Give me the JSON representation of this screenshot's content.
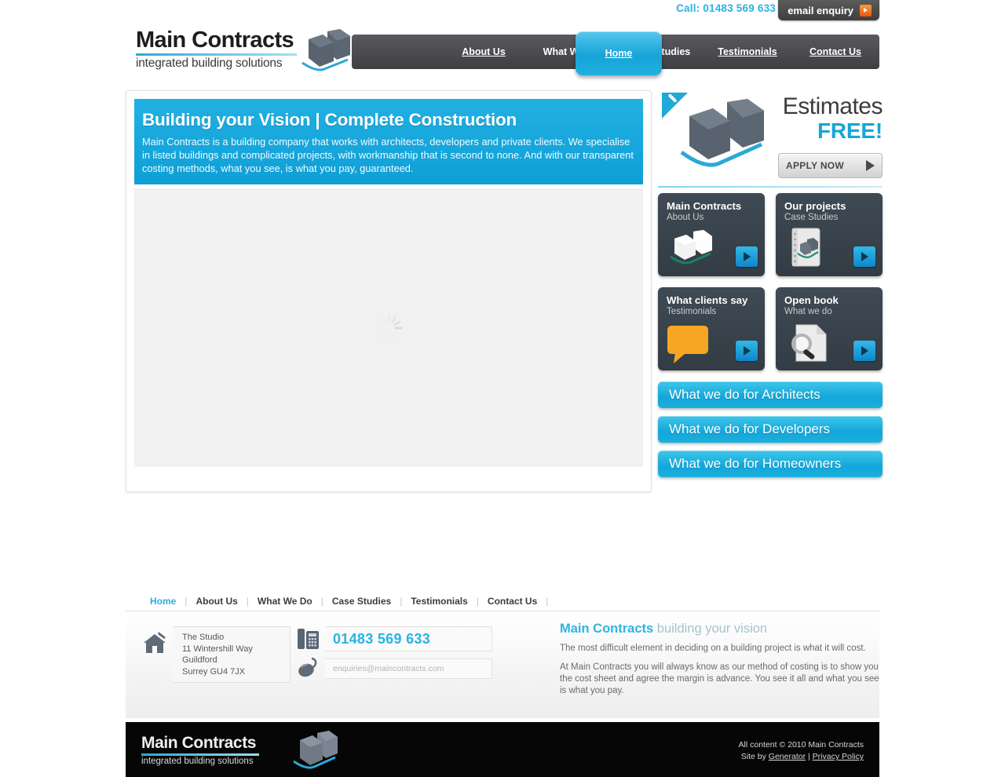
{
  "topbar": {
    "call_text": "Call: 01483 569 633",
    "email_button": "email enquiry",
    "play_icon": "orange-play-icon"
  },
  "logo": {
    "name": "Main Contracts",
    "tagline": "integrated building solutions",
    "mark": "houses-icon"
  },
  "nav": {
    "active": "Home",
    "items": [
      {
        "label": "Home"
      },
      {
        "label": "About Us"
      },
      {
        "label": "What We Do"
      },
      {
        "label": "Case Studies"
      },
      {
        "label": "Testimonials"
      },
      {
        "label": "Contact Us"
      }
    ]
  },
  "banner": {
    "heading": "Building your Vision | Complete Construction",
    "body": "Main Contracts is a building company that works with architects, developers and private clients. We specialise in listed buildings and complicated projects, with workmanship that is second to none. And with our transparent costing methods, what you see, is what you pay, guaranteed.",
    "stage_state": "loading-spinner"
  },
  "estimates": {
    "line1": "Estimates",
    "line2": "FREE!",
    "apply_label": "APPLY NOW",
    "corner_icon": "blue-corner-flag-icon",
    "house_icon": "houses-icon"
  },
  "tiles": [
    {
      "title": "Main Contracts",
      "subtitle": "About Us",
      "icon": "houses-icon"
    },
    {
      "title": "Our projects",
      "subtitle": "Case Studies",
      "icon": "notebook-icon"
    },
    {
      "title": "What clients say",
      "subtitle": "Testimonials",
      "icon": "speech-bubble-icon"
    },
    {
      "title": "Open book",
      "subtitle": "What we do",
      "icon": "magnifier-document-icon"
    }
  ],
  "ctas": [
    {
      "label": "What we do for Architects"
    },
    {
      "label": "What we do for Developers"
    },
    {
      "label": "What we do for Homeowners"
    }
  ],
  "footer_nav": {
    "active": "Home",
    "items": [
      {
        "label": "Home"
      },
      {
        "label": "About Us"
      },
      {
        "label": "What We Do"
      },
      {
        "label": "Case Studies"
      },
      {
        "label": "Testimonials"
      },
      {
        "label": "Contact Us"
      }
    ]
  },
  "contact": {
    "address_lines": [
      "The Studio",
      "11 Wintershill Way",
      "Guildford",
      "Surrey GU4 7JX"
    ],
    "phone": "01483 569 633",
    "email": "enquiries@maincontracts.com",
    "home_icon": "house-icon",
    "phone_icon": "phone-icon",
    "mail_icon": "mouse-icon"
  },
  "blurb": {
    "title_strong": "Main Contracts",
    "title_rest": " building your vision",
    "p1": "The most difficult element in deciding on a building project is what it will cost.",
    "p2": "At Main Contracts you will always know as our method of costing is to show you the cost sheet and agree the margin is advance. You see it all and what you see is what you pay."
  },
  "footer": {
    "logo_name": "Main Contracts",
    "logo_tagline": "integrated building solutions",
    "copyright": "All content © 2010 Main Contracts",
    "site_by_prefix": "Site by ",
    "site_by_link": "Generator",
    "divider": " | ",
    "privacy_link": "Privacy Policy"
  },
  "colors": {
    "brand_blue": "#1fa8da",
    "nav_dark": "#4a4a4e",
    "tile_dark": "#3a444e",
    "orange": "#e8560a",
    "black": "#060606"
  }
}
